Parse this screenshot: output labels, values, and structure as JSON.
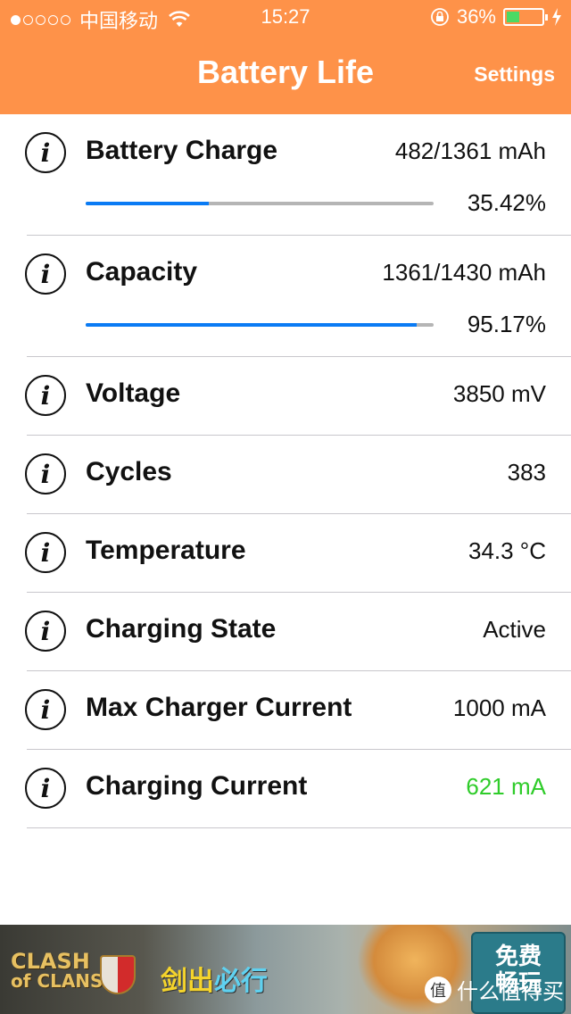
{
  "status_bar": {
    "signal_filled": 1,
    "signal_total": 5,
    "carrier": "中国移动",
    "time": "15:27",
    "battery_percent_text": "36%",
    "battery_level": 0.36,
    "battery_color": "#4cd964"
  },
  "header": {
    "title": "Battery Life",
    "settings_label": "Settings",
    "background": "#fe9249"
  },
  "rows": [
    {
      "label": "Battery Charge",
      "value": "482/1361 mAh",
      "percent_text": "35.42%",
      "progress": 0.3542
    },
    {
      "label": "Capacity",
      "value": "1361/1430 mAh",
      "percent_text": "95.17%",
      "progress": 0.9517
    },
    {
      "label": "Voltage",
      "value": "3850 mV"
    },
    {
      "label": "Cycles",
      "value": "383"
    },
    {
      "label": "Temperature",
      "value": "34.3 °C"
    },
    {
      "label": "Charging State",
      "value": "Active"
    },
    {
      "label": "Max Charger Current",
      "value": "1000 mA"
    },
    {
      "label": "Charging Current",
      "value": "621 mA",
      "value_color": "#2fcc2a"
    }
  ],
  "info_glyph": "i",
  "ad": {
    "logo_line1": "CLASH",
    "logo_line2": "of CLANS",
    "slogan_part1": "剑出",
    "slogan_part2": "必行",
    "button_label": "免费\n畅玩",
    "watermark_icon": "值",
    "watermark_text": "什么值得买"
  },
  "colors": {
    "progress_fill": "#0a7bf4",
    "progress_track": "#b5b5b5"
  }
}
